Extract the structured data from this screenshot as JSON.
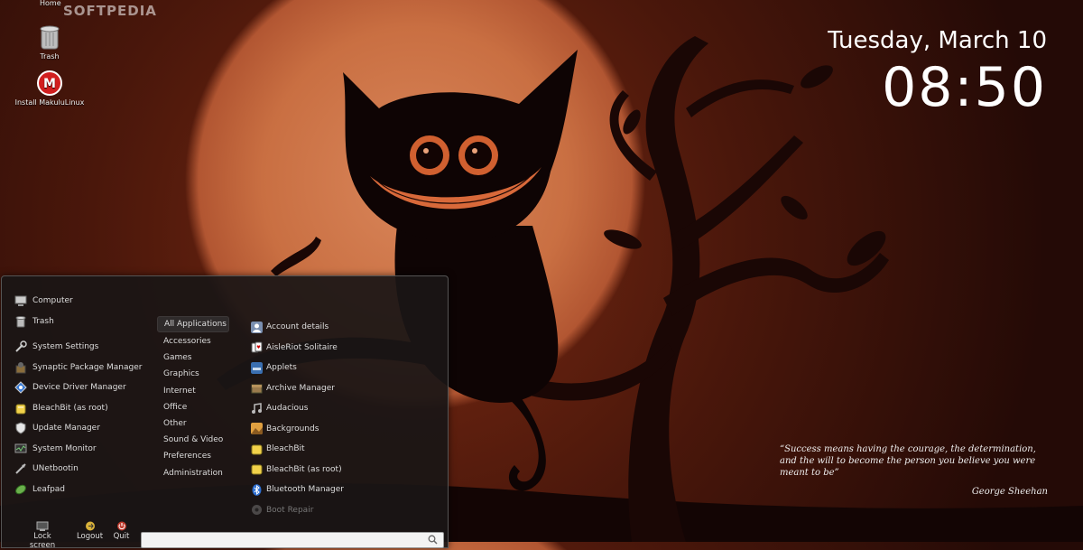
{
  "watermark": "SOFTPEDIA",
  "desktop": {
    "home_label": "Home",
    "icons": [
      {
        "label": "Trash",
        "icon": "trash-icon"
      },
      {
        "label": "Install MakuluLinux",
        "icon": "makulu-installer-icon"
      }
    ]
  },
  "clock": {
    "date": "Tuesday, March 10",
    "time": "08:50"
  },
  "quote": {
    "text": "“Success means having the courage, the determination, and the will to become the person you believe you were meant to be”",
    "author": "George Sheehan"
  },
  "menu": {
    "favorites": [
      {
        "label": "Computer",
        "icon": "computer-icon"
      },
      {
        "label": "Trash",
        "icon": "trash-icon"
      },
      {
        "label": "System Settings",
        "icon": "settings-icon"
      },
      {
        "label": "Synaptic Package Manager",
        "icon": "package-icon"
      },
      {
        "label": "Device Driver Manager",
        "icon": "driver-icon"
      },
      {
        "label": "BleachBit (as root)",
        "icon": "bleachbit-icon"
      },
      {
        "label": "Update Manager",
        "icon": "shield-icon"
      },
      {
        "label": "System Monitor",
        "icon": "monitor-icon"
      },
      {
        "label": "UNetbootin",
        "icon": "unetbootin-icon"
      },
      {
        "label": "Leafpad",
        "icon": "leafpad-icon"
      }
    ],
    "categories": [
      {
        "label": "All Applications",
        "active": true
      },
      {
        "label": "Accessories"
      },
      {
        "label": "Games"
      },
      {
        "label": "Graphics"
      },
      {
        "label": "Internet"
      },
      {
        "label": "Office"
      },
      {
        "label": "Other"
      },
      {
        "label": "Sound & Video"
      },
      {
        "label": "Preferences"
      },
      {
        "label": "Administration"
      }
    ],
    "applications": [
      {
        "label": "Account details",
        "icon": "account-icon"
      },
      {
        "label": "AisleRiot Solitaire",
        "icon": "cards-icon"
      },
      {
        "label": "Applets",
        "icon": "applets-icon"
      },
      {
        "label": "Archive Manager",
        "icon": "archive-icon"
      },
      {
        "label": "Audacious",
        "icon": "audacious-icon"
      },
      {
        "label": "Backgrounds",
        "icon": "backgrounds-icon"
      },
      {
        "label": "BleachBit",
        "icon": "bleachbit-icon"
      },
      {
        "label": "BleachBit (as root)",
        "icon": "bleachbit-icon"
      },
      {
        "label": "Bluetooth Manager",
        "icon": "bluetooth-icon"
      },
      {
        "label": "Boot Repair",
        "icon": "boot-repair-icon",
        "faded": true
      }
    ],
    "actions": {
      "lock": "Lock screen",
      "logout": "Logout",
      "quit": "Quit"
    },
    "search": {
      "value": "",
      "placeholder": ""
    }
  }
}
